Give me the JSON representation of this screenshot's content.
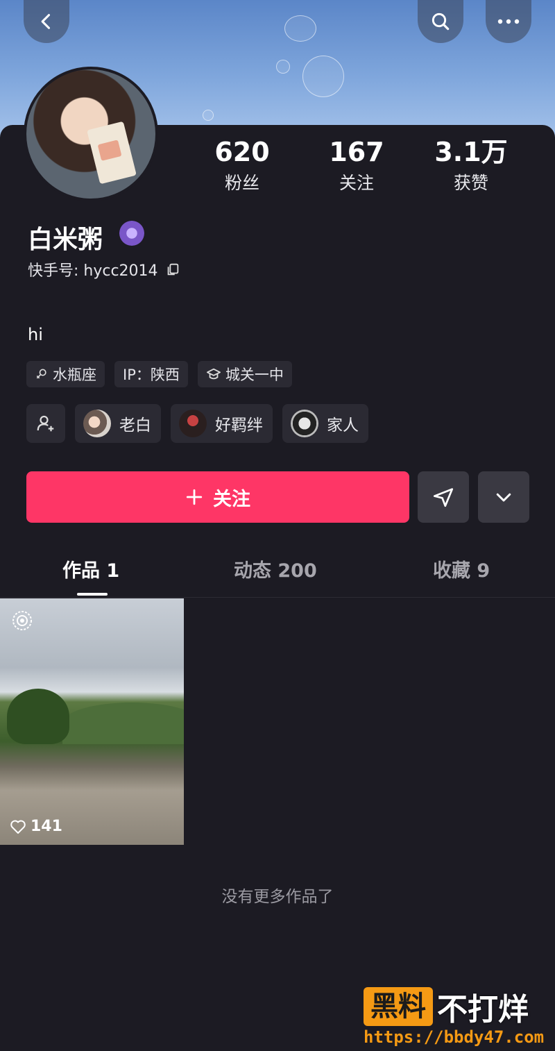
{
  "profile": {
    "stats": [
      {
        "num": "620",
        "label": "粉丝"
      },
      {
        "num": "167",
        "label": "关注"
      },
      {
        "num": "3.1万",
        "label": "获赞"
      }
    ],
    "name": "白米粥",
    "kuaishou_id": "快手号: hycc2014",
    "bio": "hi",
    "tags": [
      "水瓶座",
      "IP：陕西",
      "城关一中"
    ],
    "friends": [
      "老白",
      "好羁绊",
      "家人"
    ]
  },
  "actions": {
    "follow_label": "关注"
  },
  "tabs": [
    {
      "label": "作品 1"
    },
    {
      "label": "动态 200"
    },
    {
      "label": "收藏 9"
    }
  ],
  "works": [
    {
      "likes": "141"
    }
  ],
  "footer": {
    "no_more": "没有更多作品了"
  },
  "watermark": {
    "box": "黑料",
    "text": "不打烊",
    "url": "https://bbdy47.com"
  },
  "colors": {
    "accent": "#fe3666",
    "background": "#1c1b23"
  }
}
